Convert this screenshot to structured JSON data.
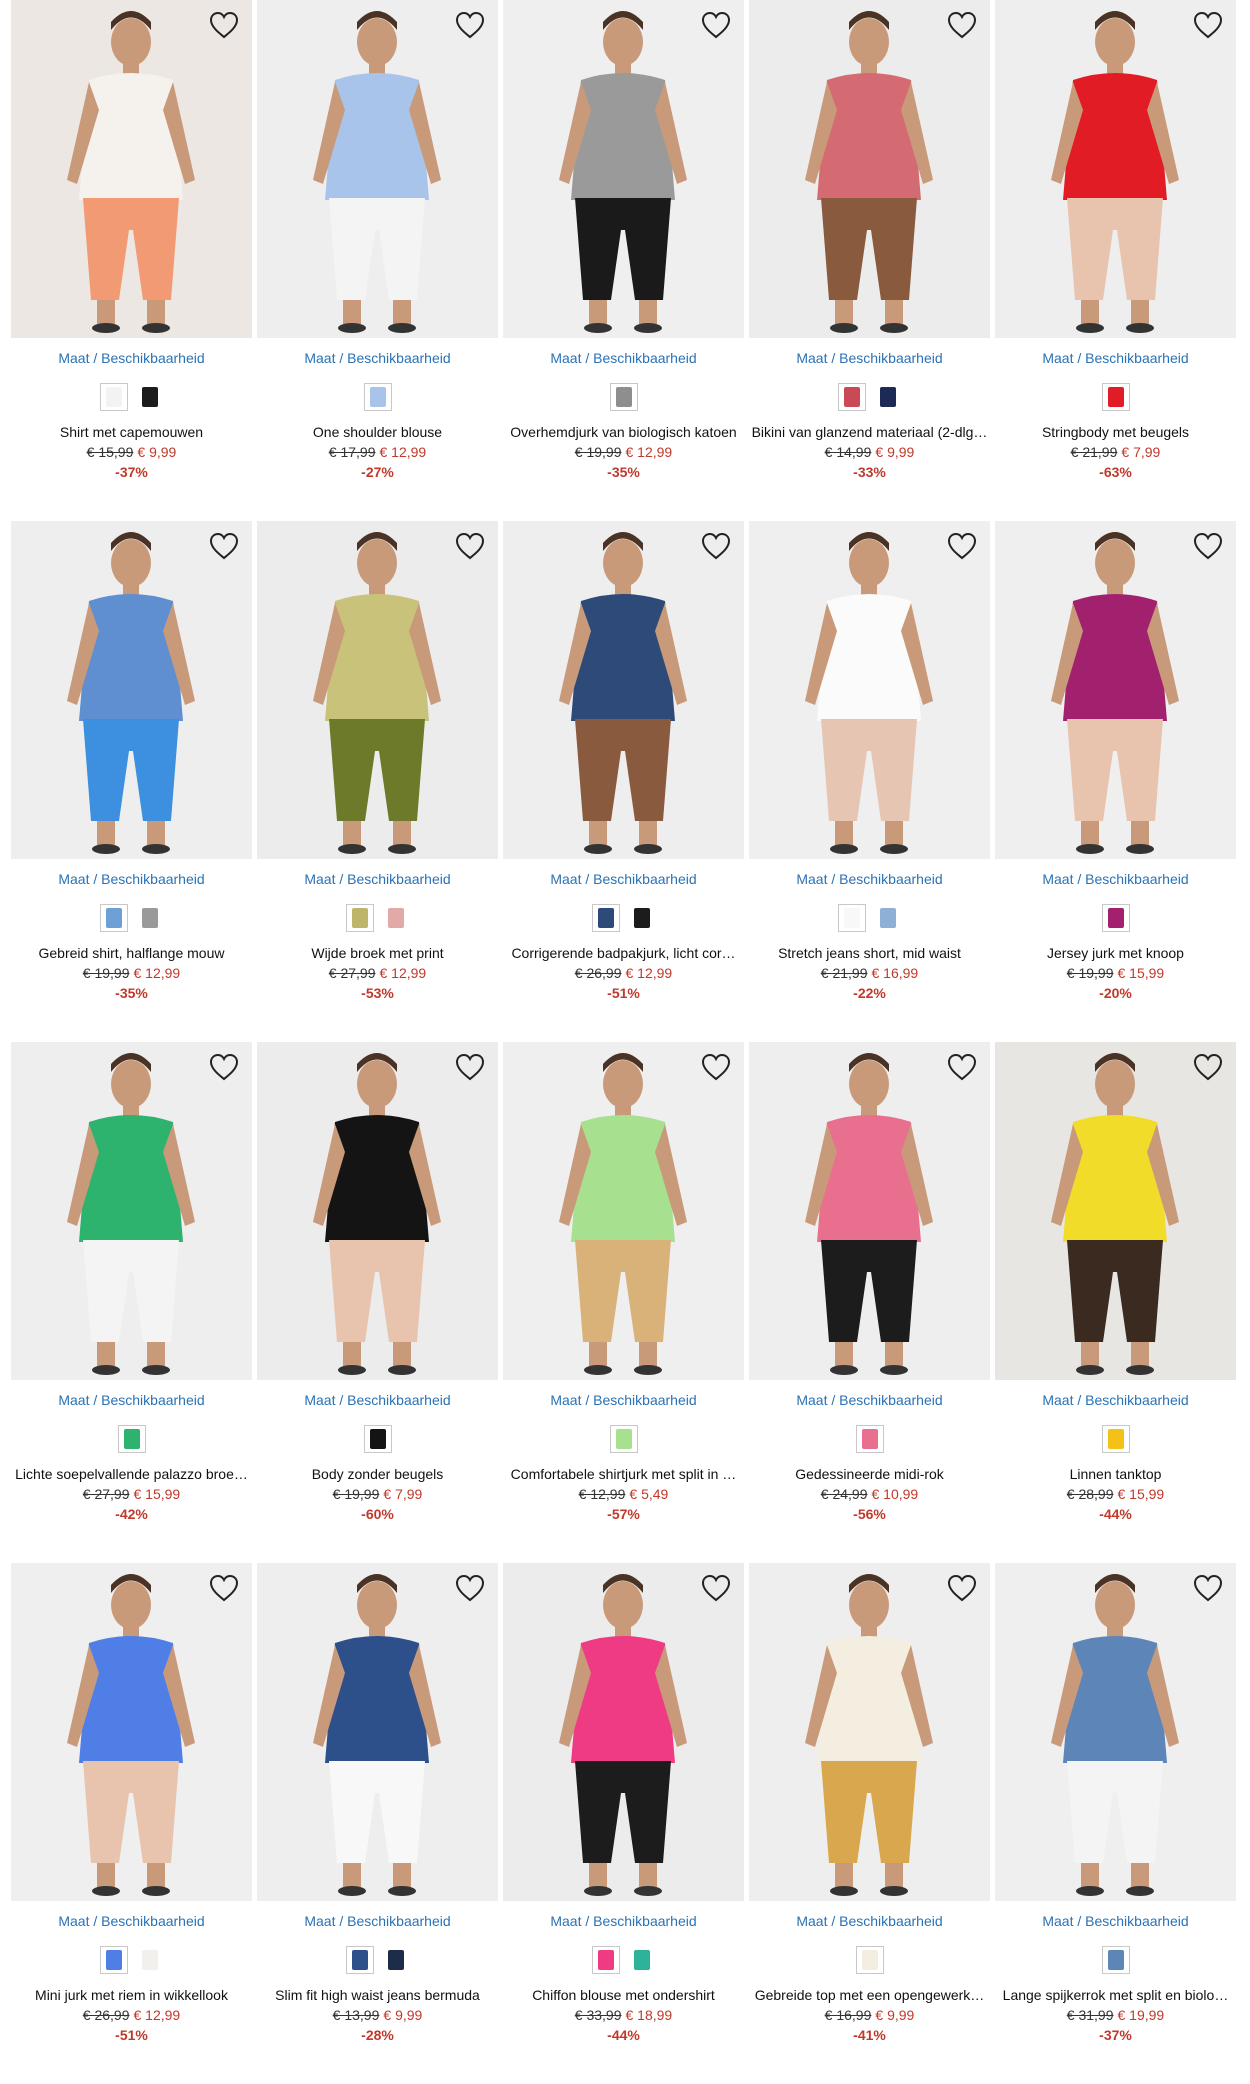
{
  "colors": {
    "link": "#2a72b5",
    "sale": "#c0392b",
    "text": "#111111"
  },
  "products": [
    {
      "name": "Shirt met capemouwen",
      "old": "€ 15,99",
      "new": "€ 9,99",
      "disc": "-37%",
      "bg": "#ece7e2",
      "garment": "#f5f2ee",
      "accent": "#f29a74",
      "swatches": [
        "#f3f3f3",
        "#1c1c1c"
      ]
    },
    {
      "name": "One shoulder blouse",
      "old": "€ 17,99",
      "new": "€ 12,99",
      "disc": "-27%",
      "bg": "#eeeeee",
      "garment": "#a9c4ea",
      "accent": "#f4f4f4",
      "swatches": [
        "#a9c4ea"
      ]
    },
    {
      "name": "Overhemdjurk van biologisch katoen",
      "old": "€ 19,99",
      "new": "€ 12,99",
      "disc": "-35%",
      "bg": "#efefef",
      "garment": "#9a9a9a",
      "accent": "#1a1a1a",
      "swatches": [
        "#8e8e8e"
      ]
    },
    {
      "name": "Bikini van glanzend materiaal (2-dlg…",
      "old": "€ 14,99",
      "new": "€ 9,99",
      "disc": "-33%",
      "bg": "#ececec",
      "garment": "#d46a72",
      "accent": "#8a5a3e",
      "swatches": [
        "#c94a55",
        "#1c2a55"
      ]
    },
    {
      "name": "Stringbody met beugels",
      "old": "€ 21,99",
      "new": "€ 7,99",
      "disc": "-63%",
      "bg": "#eeeeee",
      "garment": "#e21c24",
      "accent": "#e8c3ad",
      "swatches": [
        "#e21c24"
      ]
    },
    {
      "name": "Gebreid shirt, halflange mouw",
      "old": "€ 19,99",
      "new": "€ 12,99",
      "disc": "-35%",
      "bg": "#eeeeee",
      "garment": "#5f8fd0",
      "accent": "#3d8fe0",
      "swatches": [
        "#6e9fd6",
        "#9a9a9a"
      ]
    },
    {
      "name": "Wijde broek met print",
      "old": "€ 27,99",
      "new": "€ 12,99",
      "disc": "-53%",
      "bg": "#ececec",
      "garment": "#c9c27a",
      "accent": "#6d7a2a",
      "swatches": [
        "#bfb56a",
        "#e3a8a8"
      ]
    },
    {
      "name": "Corrigerende badpakjurk, licht cor…",
      "old": "€ 26,99",
      "new": "€ 12,99",
      "disc": "-51%",
      "bg": "#eeeeee",
      "garment": "#2d4a78",
      "accent": "#8a5a3e",
      "swatches": [
        "#2d4a78",
        "#1c1c1c"
      ]
    },
    {
      "name": "Stretch jeans short, mid waist",
      "old": "€ 21,99",
      "new": "€ 16,99",
      "disc": "-22%",
      "bg": "#efefef",
      "garment": "#fbfbfb",
      "accent": "#e6c6b2",
      "swatches": [
        "#f8f8f8",
        "#8fb0d6"
      ]
    },
    {
      "name": "Jersey jurk met knoop",
      "old": "€ 19,99",
      "new": "€ 15,99",
      "disc": "-20%",
      "bg": "#efefef",
      "garment": "#a2216e",
      "accent": "#e8c3ad",
      "swatches": [
        "#a2216e"
      ]
    },
    {
      "name": "Lichte soepelvallende palazzo broe…",
      "old": "€ 27,99",
      "new": "€ 15,99",
      "disc": "-42%",
      "bg": "#eeeeee",
      "garment": "#2db36e",
      "accent": "#f4f4f4",
      "swatches": [
        "#2db36e"
      ]
    },
    {
      "name": "Body zonder beugels",
      "old": "€ 19,99",
      "new": "€ 7,99",
      "disc": "-60%",
      "bg": "#ececec",
      "garment": "#141414",
      "accent": "#e8c3ad",
      "swatches": [
        "#141414"
      ]
    },
    {
      "name": "Comfortabele shirtjurk met split in …",
      "old": "€ 12,99",
      "new": "€ 5,49",
      "disc": "-57%",
      "bg": "#efefef",
      "garment": "#a7e08f",
      "accent": "#d9b27a",
      "swatches": [
        "#a7e08f"
      ]
    },
    {
      "name": "Gedessineerde midi-rok",
      "old": "€ 24,99",
      "new": "€ 10,99",
      "disc": "-56%",
      "bg": "#eeeeee",
      "garment": "#e86f8d",
      "accent": "#1c1c1c",
      "swatches": [
        "#e86f8d"
      ]
    },
    {
      "name": "Linnen tanktop",
      "old": "€ 28,99",
      "new": "€ 15,99",
      "disc": "-44%",
      "bg": "#e8e6e3",
      "garment": "#f2dc2a",
      "accent": "#3b2a20",
      "swatches": [
        "#f2c218"
      ]
    },
    {
      "name": "Mini jurk met riem in wikkellook",
      "old": "€ 26,99",
      "new": "€ 12,99",
      "disc": "-51%",
      "bg": "#efefef",
      "garment": "#4f7fe6",
      "accent": "#e8c3ad",
      "swatches": [
        "#4f7fe6",
        "#f2f0ea"
      ]
    },
    {
      "name": "Slim fit high waist jeans bermuda",
      "old": "€ 13,99",
      "new": "€ 9,99",
      "disc": "-28%",
      "bg": "#eeeeee",
      "garment": "#2d4f8a",
      "accent": "#f8f8f8",
      "swatches": [
        "#2d4f8a",
        "#1c2d4a"
      ]
    },
    {
      "name": "Chiffon blouse met ondershirt",
      "old": "€ 33,99",
      "new": "€ 18,99",
      "disc": "-44%",
      "bg": "#ececec",
      "garment": "#ef3b83",
      "accent": "#1c1c1c",
      "swatches": [
        "#ef3b83",
        "#2db39a"
      ]
    },
    {
      "name": "Gebreide top met een opengewerk…",
      "old": "€ 16,99",
      "new": "€ 9,99",
      "disc": "-41%",
      "bg": "#eeeeee",
      "garment": "#f4eee0",
      "accent": "#d9a84e",
      "swatches": [
        "#f4eee0"
      ]
    },
    {
      "name": "Lange spijkerrok met split en biolo…",
      "old": "€ 31,99",
      "new": "€ 19,99",
      "disc": "-37%",
      "bg": "#efefef",
      "garment": "#5d85b8",
      "accent": "#f4f4f4",
      "swatches": [
        "#5d85b8"
      ]
    }
  ],
  "labels": {
    "maat": "Maat / Beschikbaarheid"
  }
}
